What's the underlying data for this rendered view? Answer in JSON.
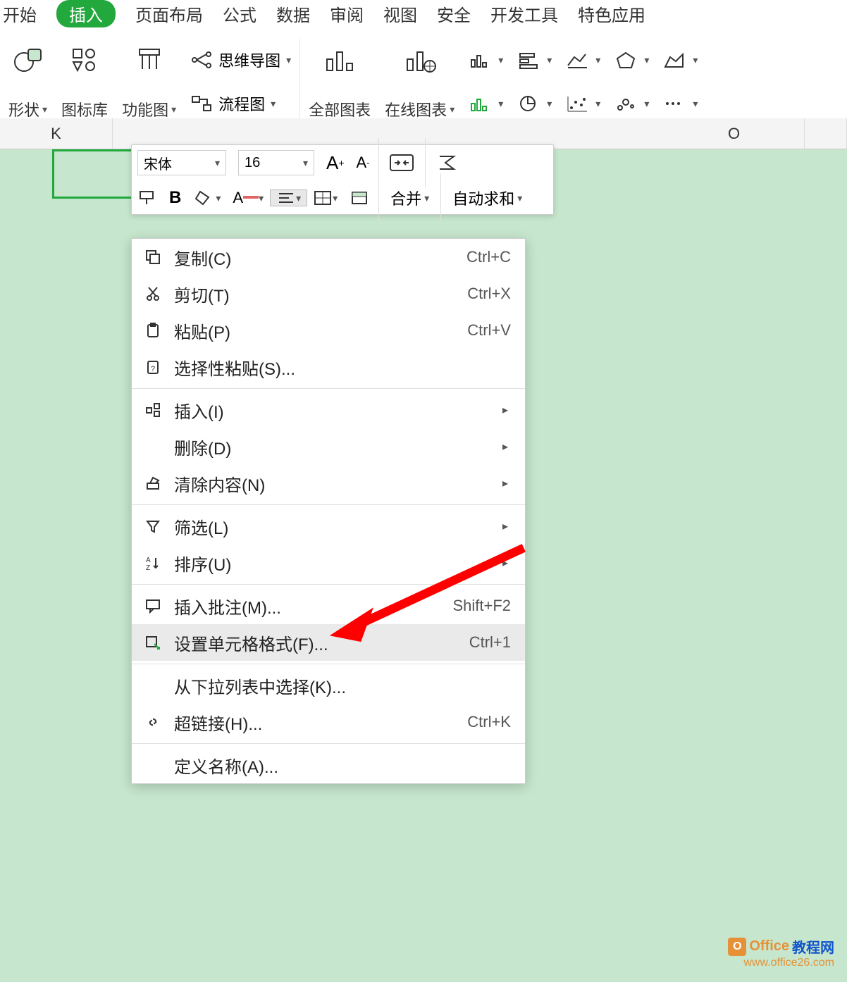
{
  "tabs": {
    "start": "开始",
    "insert": "插入",
    "page_layout": "页面布局",
    "formula": "公式",
    "data": "数据",
    "review": "审阅",
    "view": "视图",
    "security": "安全",
    "developer": "开发工具",
    "feature": "特色应用"
  },
  "ribbon": {
    "shapes": "形状",
    "icon_lib": "图标库",
    "function_chart": "功能图",
    "mindmap": "思维导图",
    "flowchart": "流程图",
    "all_charts": "全部图表",
    "online_charts": "在线图表"
  },
  "columns": {
    "k": "K",
    "o": "O"
  },
  "mini_toolbar": {
    "font": "宋体",
    "size": "16",
    "merge": "合并",
    "autosum": "自动求和"
  },
  "context": {
    "copy": {
      "label": "复制(C)",
      "shortcut": "Ctrl+C"
    },
    "cut": {
      "label": "剪切(T)",
      "shortcut": "Ctrl+X"
    },
    "paste": {
      "label": "粘贴(P)",
      "shortcut": "Ctrl+V"
    },
    "paste_special": {
      "label": "选择性粘贴(S)..."
    },
    "insert": {
      "label": "插入(I)"
    },
    "delete": {
      "label": "删除(D)"
    },
    "clear": {
      "label": "清除内容(N)"
    },
    "filter": {
      "label": "筛选(L)"
    },
    "sort": {
      "label": "排序(U)"
    },
    "comment": {
      "label": "插入批注(M)...",
      "shortcut": "Shift+F2"
    },
    "format": {
      "label": "设置单元格格式(F)...",
      "shortcut": "Ctrl+1"
    },
    "dropdown": {
      "label": "从下拉列表中选择(K)..."
    },
    "hyperlink": {
      "label": "超链接(H)...",
      "shortcut": "Ctrl+K"
    },
    "define_name": {
      "label": "定义名称(A)..."
    }
  },
  "watermark": {
    "brand1": "Office",
    "brand2": "教程网",
    "url": "www.office26.com"
  }
}
